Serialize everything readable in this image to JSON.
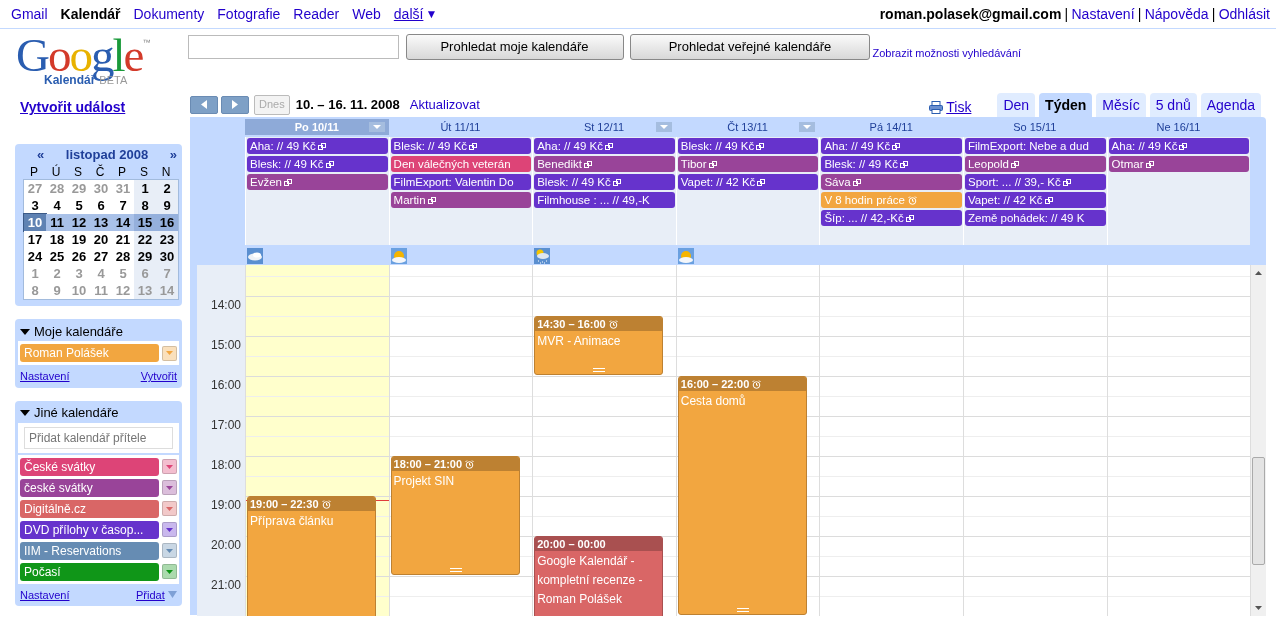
{
  "top_bar": {
    "apps": [
      {
        "label": "Gmail",
        "selected": false
      },
      {
        "label": "Kalendář",
        "selected": true
      },
      {
        "label": "Dokumenty",
        "selected": false
      },
      {
        "label": "Fotografie",
        "selected": false
      },
      {
        "label": "Reader",
        "selected": false
      },
      {
        "label": "Web",
        "selected": false
      }
    ],
    "more": {
      "label": "další",
      "arrow": "▼"
    },
    "account": "roman.polasek@gmail.com",
    "separator": "|",
    "links": [
      "Nastavení",
      "Nápověda",
      "Odhlásit"
    ]
  },
  "logo": {
    "wordmark": "Google",
    "trademark": "™",
    "product": "Kalendář",
    "tag": "BETA"
  },
  "search": {
    "buttons": [
      "Prohledat moje kalendáře",
      "Prohledat veřejné kalendáře"
    ],
    "options_link": "Zobrazit možnosti vyhledávání"
  },
  "create_event": "Vytvořit událost",
  "mini_calendar": {
    "prev": "«",
    "title": "listopad 2008",
    "next": "»",
    "weekdays": [
      "P",
      "Ú",
      "S",
      "Č",
      "P",
      "S",
      "N"
    ],
    "weeks": [
      [
        {
          "text": "27",
          "other_month": true,
          "selected": false,
          "today": false
        },
        {
          "text": "28",
          "other_month": true,
          "selected": false,
          "today": false
        },
        {
          "text": "29",
          "other_month": true,
          "selected": false,
          "today": false
        },
        {
          "text": "30",
          "other_month": true,
          "selected": false,
          "today": false
        },
        {
          "text": "31",
          "other_month": true,
          "selected": false,
          "today": false
        },
        {
          "text": "1",
          "other_month": false,
          "selected": false,
          "today": false
        },
        {
          "text": "2",
          "other_month": false,
          "selected": false,
          "today": false
        }
      ],
      [
        {
          "text": "3",
          "other_month": false,
          "selected": false,
          "today": false
        },
        {
          "text": "4",
          "other_month": false,
          "selected": false,
          "today": false
        },
        {
          "text": "5",
          "other_month": false,
          "selected": false,
          "today": false
        },
        {
          "text": "6",
          "other_month": false,
          "selected": false,
          "today": false
        },
        {
          "text": "7",
          "other_month": false,
          "selected": false,
          "today": false
        },
        {
          "text": "8",
          "other_month": false,
          "selected": false,
          "today": false
        },
        {
          "text": "9",
          "other_month": false,
          "selected": false,
          "today": false
        }
      ],
      [
        {
          "text": "10",
          "other_month": false,
          "selected": true,
          "today": true
        },
        {
          "text": "11",
          "other_month": false,
          "selected": true,
          "today": false
        },
        {
          "text": "12",
          "other_month": false,
          "selected": true,
          "today": false
        },
        {
          "text": "13",
          "other_month": false,
          "selected": true,
          "today": false
        },
        {
          "text": "14",
          "other_month": false,
          "selected": true,
          "today": false
        },
        {
          "text": "15",
          "other_month": false,
          "selected": true,
          "today": false
        },
        {
          "text": "16",
          "other_month": false,
          "selected": true,
          "today": false
        }
      ],
      [
        {
          "text": "17",
          "other_month": false,
          "selected": false,
          "today": false
        },
        {
          "text": "18",
          "other_month": false,
          "selected": false,
          "today": false
        },
        {
          "text": "19",
          "other_month": false,
          "selected": false,
          "today": false
        },
        {
          "text": "20",
          "other_month": false,
          "selected": false,
          "today": false
        },
        {
          "text": "21",
          "other_month": false,
          "selected": false,
          "today": false
        },
        {
          "text": "22",
          "other_month": false,
          "selected": false,
          "today": false
        },
        {
          "text": "23",
          "other_month": false,
          "selected": false,
          "today": false
        }
      ],
      [
        {
          "text": "24",
          "other_month": false,
          "selected": false,
          "today": false
        },
        {
          "text": "25",
          "other_month": false,
          "selected": false,
          "today": false
        },
        {
          "text": "26",
          "other_month": false,
          "selected": false,
          "today": false
        },
        {
          "text": "27",
          "other_month": false,
          "selected": false,
          "today": false
        },
        {
          "text": "28",
          "other_month": false,
          "selected": false,
          "today": false
        },
        {
          "text": "29",
          "other_month": false,
          "selected": false,
          "today": false
        },
        {
          "text": "30",
          "other_month": false,
          "selected": false,
          "today": false
        }
      ],
      [
        {
          "text": "1",
          "other_month": true,
          "selected": false,
          "today": false
        },
        {
          "text": "2",
          "other_month": true,
          "selected": false,
          "today": false
        },
        {
          "text": "3",
          "other_month": true,
          "selected": false,
          "today": false
        },
        {
          "text": "4",
          "other_month": true,
          "selected": false,
          "today": false
        },
        {
          "text": "5",
          "other_month": true,
          "selected": false,
          "today": false
        },
        {
          "text": "6",
          "other_month": true,
          "selected": false,
          "today": false
        },
        {
          "text": "7",
          "other_month": true,
          "selected": false,
          "today": false
        }
      ],
      [
        {
          "text": "8",
          "other_month": true,
          "selected": false,
          "today": false
        },
        {
          "text": "9",
          "other_month": true,
          "selected": false,
          "today": false
        },
        {
          "text": "10",
          "other_month": true,
          "selected": false,
          "today": false
        },
        {
          "text": "11",
          "other_month": true,
          "selected": false,
          "today": false
        },
        {
          "text": "12",
          "other_month": true,
          "selected": false,
          "today": false
        },
        {
          "text": "13",
          "other_month": true,
          "selected": false,
          "today": false
        },
        {
          "text": "14",
          "other_month": true,
          "selected": false,
          "today": false
        }
      ]
    ]
  },
  "my_calendars": {
    "title": "Moje kalendáře",
    "expanded": true,
    "items": [
      {
        "name": "Roman Polášek",
        "color": "#f2a640"
      }
    ],
    "links": [
      "Nastavení",
      "Vytvořit"
    ]
  },
  "other_calendars": {
    "title": "Jiné kalendáře",
    "expanded": true,
    "add_field": {
      "placeholder": "Přidat kalendář přítele"
    },
    "items": [
      {
        "name": "České svátky",
        "color": "#dd4477"
      },
      {
        "name": "české svátky",
        "color": "#994499"
      },
      {
        "name": "Digitálně.cz",
        "color": "#d96666"
      },
      {
        "name": "DVD přílohy v časop...",
        "color": "#6633cc"
      },
      {
        "name": "IIM - Reservations",
        "color": "#668cb3"
      },
      {
        "name": "Počasí",
        "color": "#109618"
      }
    ],
    "links": [
      "Nastavení",
      "Přidat"
    ]
  },
  "toolbar": {
    "today_button": {
      "label": "Dnes",
      "disabled": true
    },
    "date_range": "10. – 16. 11. 2008",
    "refresh": "Aktualizovat",
    "print": "Tisk",
    "views": [
      {
        "label": "Den",
        "selected": false
      },
      {
        "label": "Týden",
        "selected": true
      },
      {
        "label": "Měsíc",
        "selected": false
      },
      {
        "label": "5 dnů",
        "selected": false
      },
      {
        "label": "Agenda",
        "selected": false
      }
    ]
  },
  "hours": [
    "14:00",
    "15:00",
    "16:00",
    "17:00",
    "18:00",
    "19:00",
    "20:00",
    "21:00"
  ],
  "days": [
    {
      "label": "Po 10/11",
      "today": true,
      "menu": true,
      "weather": {
        "kind": "cloudy"
      },
      "all_day": [
        {
          "title": "Aha: // 49 Kč",
          "color": "#6633cc",
          "kind": "repeat"
        },
        {
          "title": "Blesk: // 49 Kč",
          "color": "#6633cc",
          "kind": "repeat"
        },
        {
          "title": "Evžen",
          "color": "#994499",
          "kind": "repeat"
        }
      ],
      "events": [
        {
          "time": "19:00 – 22:30",
          "title": "Příprava článku",
          "alarm": true,
          "color": "#f2a640"
        }
      ]
    },
    {
      "label": "Út 11/11",
      "today": false,
      "menu": false,
      "weather": {
        "kind": "partly_sunny"
      },
      "all_day": [
        {
          "title": "Blesk: // 49 Kč",
          "color": "#6633cc",
          "kind": "repeat"
        },
        {
          "title": "Den válečných veterán",
          "color": "#dd4477",
          "kind": "cut"
        },
        {
          "title": "FilmExport: Valentin Do",
          "color": "#6633cc",
          "kind": "cut"
        },
        {
          "title": "Martin",
          "color": "#994499",
          "kind": "repeat"
        }
      ],
      "events": [
        {
          "time": "18:00 – 21:00",
          "title": "Projekt SIN",
          "alarm": true,
          "color": "#f2a640"
        }
      ]
    },
    {
      "label": "St 12/11",
      "today": false,
      "menu": true,
      "weather": {
        "kind": "snow"
      },
      "all_day": [
        {
          "title": "Aha: // 49 Kč",
          "color": "#6633cc",
          "kind": "repeat"
        },
        {
          "title": "Benedikt",
          "color": "#994499",
          "kind": "repeat"
        },
        {
          "title": "Blesk: // 49 Kč",
          "color": "#6633cc",
          "kind": "repeat"
        },
        {
          "title": "Filmhouse : ... // 49,-K",
          "color": "#6633cc",
          "kind": "cut"
        }
      ],
      "events": [
        {
          "time": "14:30 – 16:00",
          "title": "MVR - Animace",
          "alarm": true,
          "color": "#f2a640"
        },
        {
          "time": "20:00 – 00:00",
          "title": "Google Kalendář - kompletní recenze - Roman Polášek",
          "alarm": false,
          "color": "#d96666"
        }
      ]
    },
    {
      "label": "Čt 13/11",
      "today": false,
      "menu": true,
      "weather": {
        "kind": "partly_sunny"
      },
      "all_day": [
        {
          "title": "Blesk: // 49 Kč",
          "color": "#6633cc",
          "kind": "repeat"
        },
        {
          "title": "Tibor",
          "color": "#994499",
          "kind": "repeat"
        },
        {
          "title": "Vapet: // 42 Kč",
          "color": "#6633cc",
          "kind": "repeat"
        }
      ],
      "events": [
        {
          "time": "16:00 – 22:00",
          "title": "Cesta domů",
          "alarm": true,
          "color": "#f2a640"
        }
      ]
    },
    {
      "label": "Pá 14/11",
      "today": false,
      "menu": false,
      "all_day": [
        {
          "title": "Aha: // 49 Kč",
          "color": "#6633cc",
          "kind": "repeat"
        },
        {
          "title": "Blesk: // 49 Kč",
          "color": "#6633cc",
          "kind": "repeat"
        },
        {
          "title": "Sáva",
          "color": "#994499",
          "kind": "repeat"
        },
        {
          "title": "V 8 hodin práce",
          "color": "#f2a640",
          "kind": "alarm"
        },
        {
          "title": "Šíp: ... // 42,-Kč",
          "color": "#6633cc",
          "kind": "repeat"
        }
      ]
    },
    {
      "label": "So 15/11",
      "today": false,
      "menu": false,
      "all_day": [
        {
          "title": "FilmExport: Nebe a dud",
          "color": "#6633cc",
          "kind": "cut"
        },
        {
          "title": "Leopold",
          "color": "#994499",
          "kind": "repeat"
        },
        {
          "title": "Sport: ... // 39,- Kč",
          "color": "#6633cc",
          "kind": "repeat"
        },
        {
          "title": "Vapet: // 42 Kč",
          "color": "#6633cc",
          "kind": "repeat"
        },
        {
          "title": "Země pohádek: // 49 K",
          "color": "#6633cc",
          "kind": "cut"
        }
      ]
    },
    {
      "label": "Ne 16/11",
      "today": false,
      "menu": false,
      "all_day": [
        {
          "title": "Aha: // 49 Kč",
          "color": "#6633cc",
          "kind": "repeat"
        },
        {
          "title": "Otmar",
          "color": "#994499",
          "kind": "repeat"
        }
      ]
    }
  ]
}
